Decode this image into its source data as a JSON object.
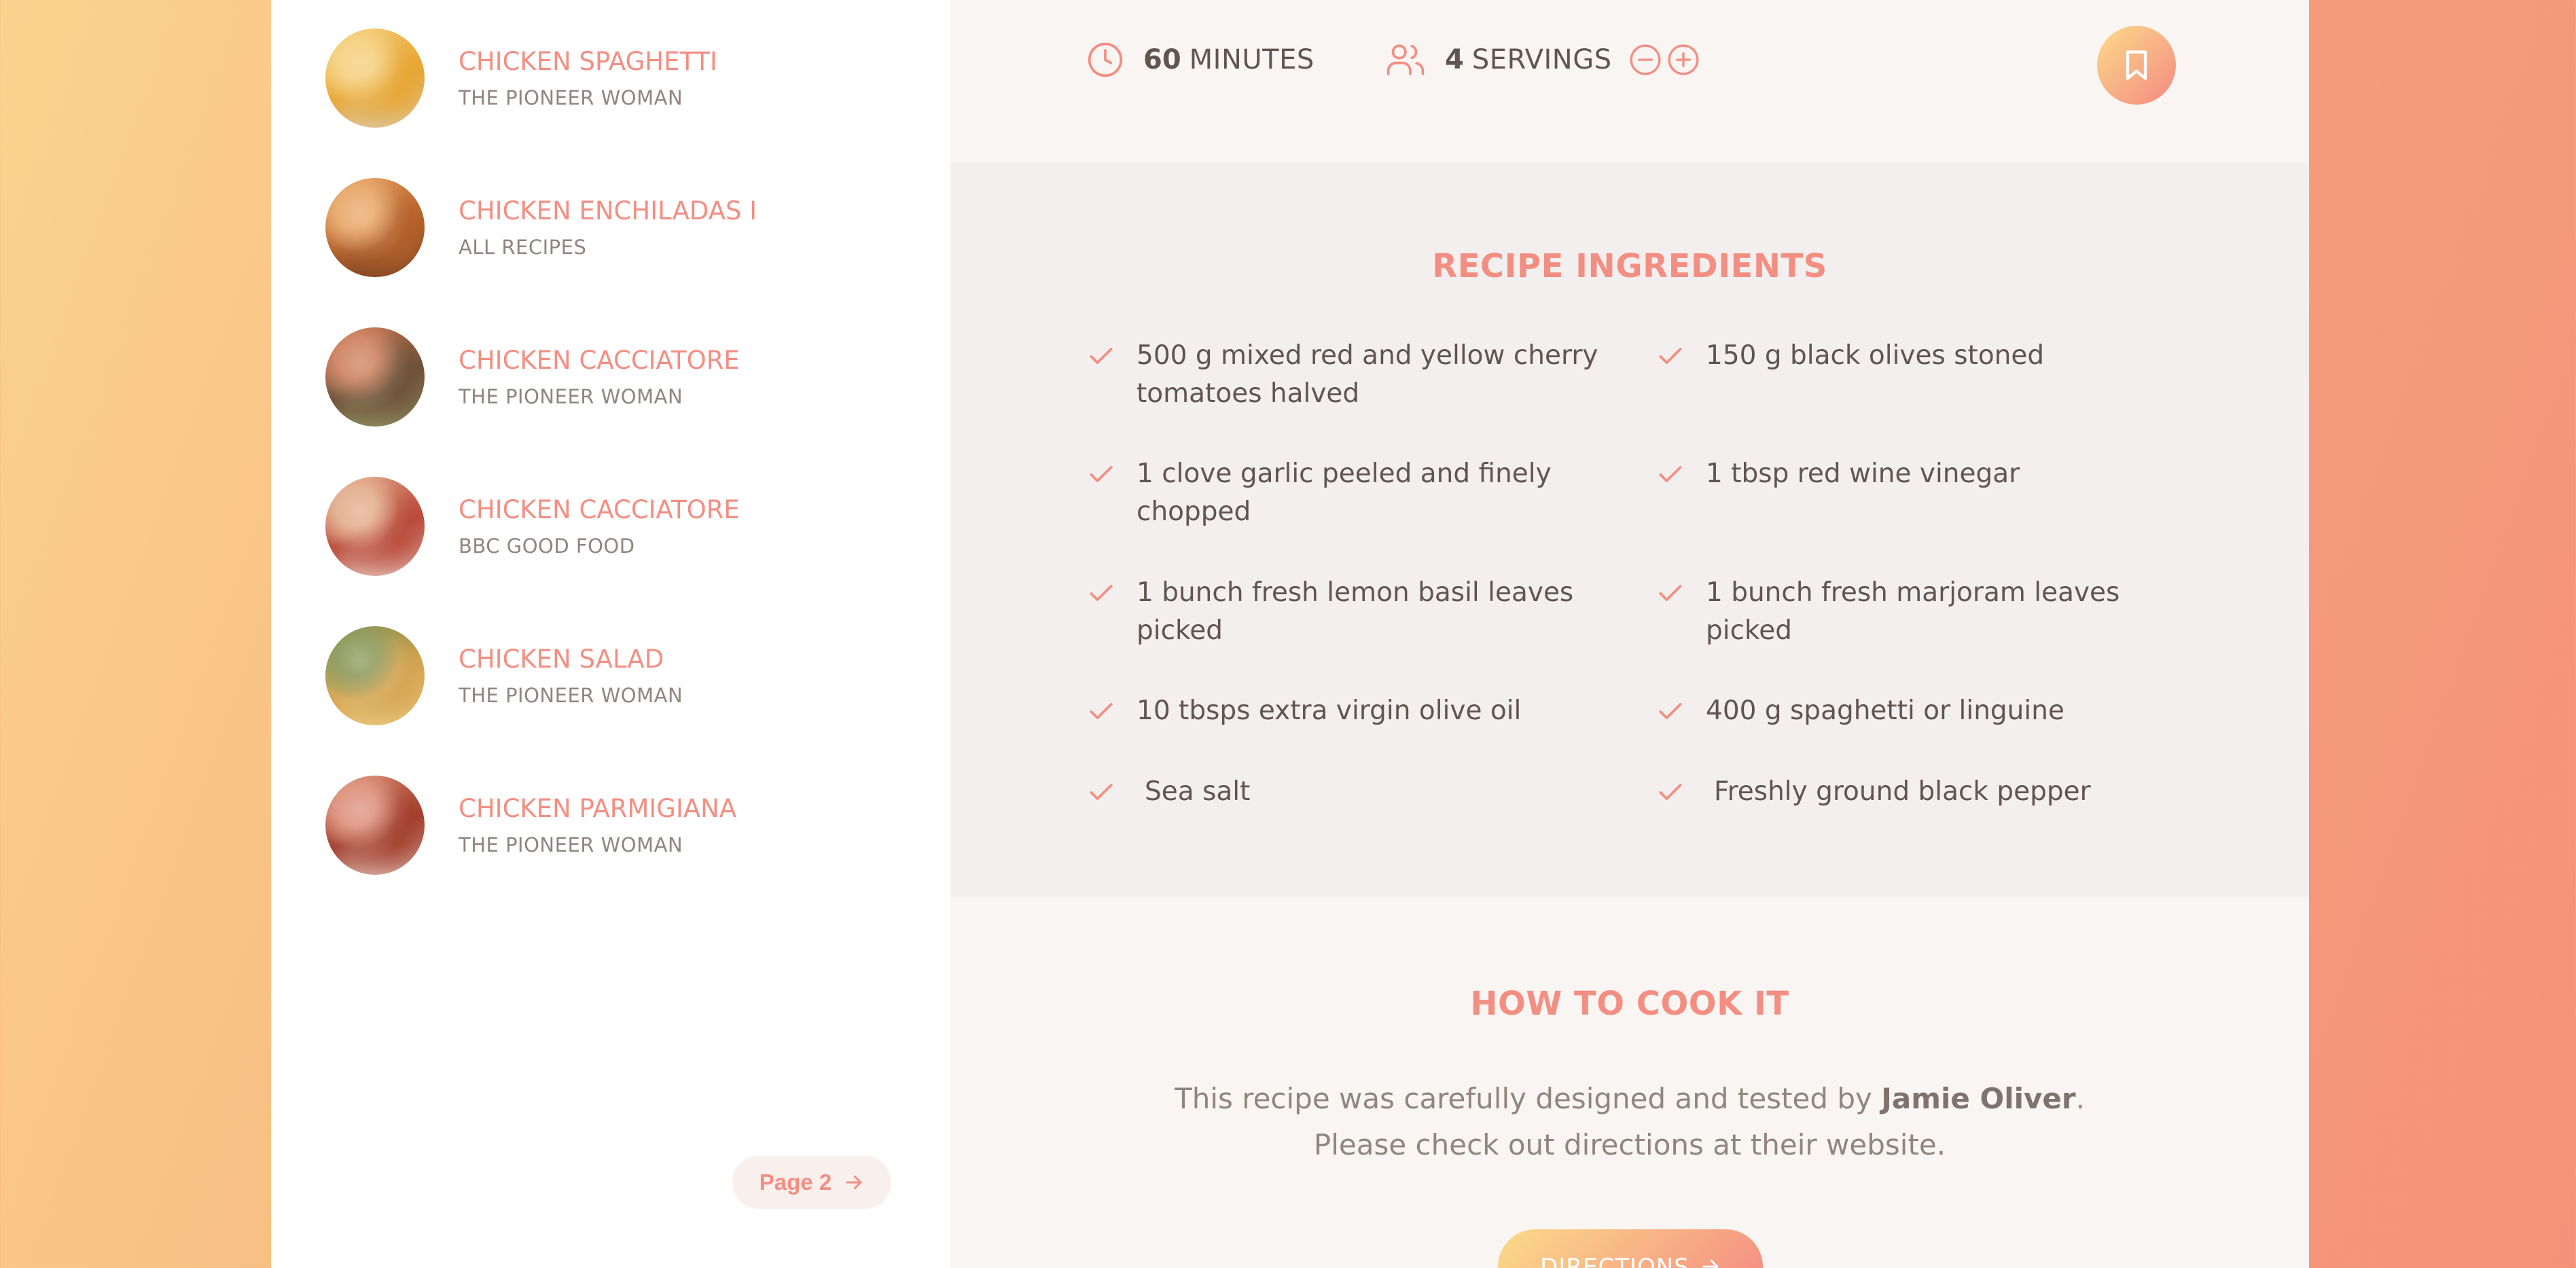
{
  "results": [
    {
      "title": "CHICKEN SPAGHETTI",
      "publisher": "THE PIONEER WOMAN",
      "img_colors": [
        "#e7a634",
        "#f3c86a",
        "#d9d2c8"
      ]
    },
    {
      "title": "CHICKEN ENCHILADAS I",
      "publisher": "ALL RECIPES",
      "img_colors": [
        "#b5622b",
        "#e59b54",
        "#6d3a22"
      ]
    },
    {
      "title": "CHICKEN CACCIATORE",
      "publisher": "THE PIONEER WOMAN",
      "img_colors": [
        "#6e5138",
        "#c77049",
        "#9aa36d"
      ]
    },
    {
      "title": "CHICKEN CACCIATORE",
      "publisher": "BBC GOOD FOOD",
      "img_colors": [
        "#b94a3a",
        "#e0a27e",
        "#f1e3dc"
      ]
    },
    {
      "title": "CHICKEN SALAD",
      "publisher": "THE PIONEER WOMAN",
      "img_colors": [
        "#d4a552",
        "#7d8a43",
        "#f1d38d"
      ]
    },
    {
      "title": "CHICKEN PARMIGIANA",
      "publisher": "THE PIONEER WOMAN",
      "img_colors": [
        "#a23e2d",
        "#d8826a",
        "#e9d9cf"
      ]
    }
  ],
  "pagination": {
    "label": "Page 2"
  },
  "recipe": {
    "minutes_value": "60",
    "minutes_label": "MINUTES",
    "servings_value": "4",
    "servings_label": "SERVINGS"
  },
  "ingredients": {
    "heading": "RECIPE INGREDIENTS",
    "items": [
      {
        "text": "500 g mixed red and yellow cherry tomatoes halved"
      },
      {
        "text": "150 g black olives stoned"
      },
      {
        "text": "1 clove garlic peeled and finely chopped"
      },
      {
        "text": "1 tbsp red wine vinegar"
      },
      {
        "text": "1 bunch fresh lemon basil leaves picked"
      },
      {
        "text": "1 bunch fresh marjoram leaves picked"
      },
      {
        "text": "10 tbsps extra virgin olive oil"
      },
      {
        "text": "400 g spaghetti or linguine"
      },
      {
        "text": "Sea salt"
      },
      {
        "text": "Freshly ground black pepper"
      }
    ]
  },
  "cooking": {
    "heading": "HOW TO COOK IT",
    "desc_prefix": "This recipe was carefully designed and tested by ",
    "author": "Jamie Oliver",
    "desc_suffix": ". Please check out directions at their website.",
    "button_label": "DIRECTIONS"
  },
  "colors": {
    "accent": "#f38e82",
    "accent_light": "#fbdb89",
    "text": "#615551"
  }
}
